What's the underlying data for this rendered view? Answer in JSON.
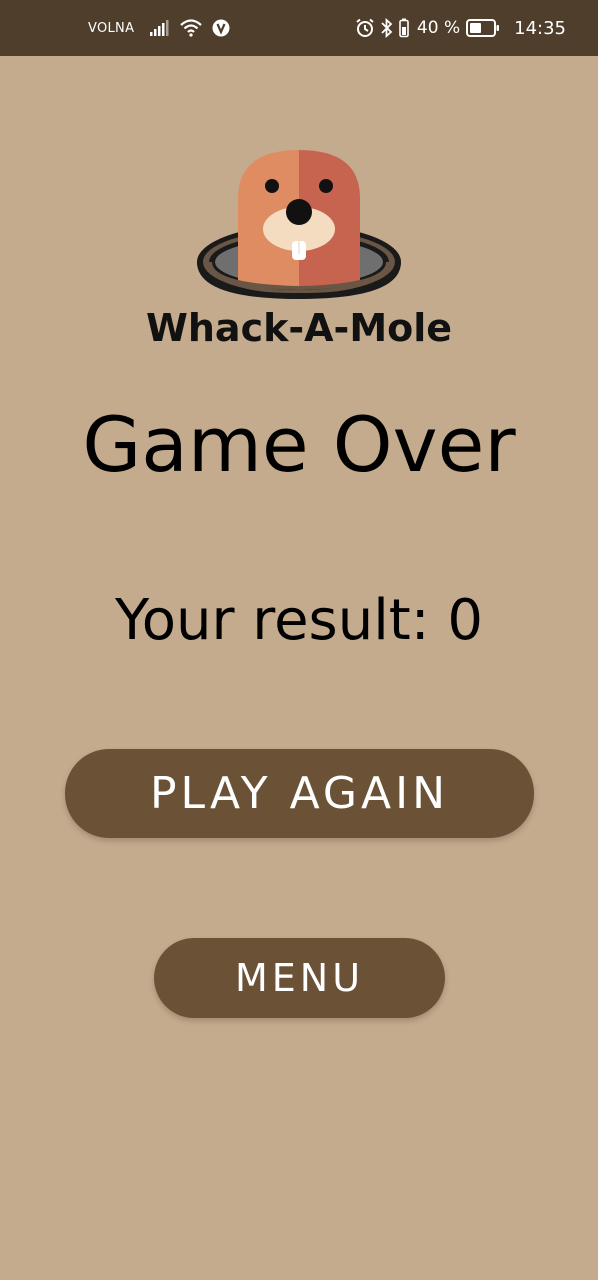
{
  "status_bar": {
    "carrier": "VOLNA",
    "battery_percent": "40 %",
    "time": "14:35",
    "icons": [
      "signal-icon",
      "wifi-icon",
      "volte-icon",
      "alarm-icon",
      "bluetooth-icon",
      "battery-saver-icon",
      "battery-icon"
    ]
  },
  "logo": {
    "text": "Whack-A-Mole"
  },
  "screen": {
    "title": "Game Over",
    "result_text": "Your result: 0"
  },
  "buttons": {
    "play_again": "PLAY AGAIN",
    "menu": "MENU"
  },
  "colors": {
    "background": "#c4ab8d",
    "status_bar": "#4f3e2b",
    "button": "#6b5237",
    "button_text": "#ffffff"
  }
}
